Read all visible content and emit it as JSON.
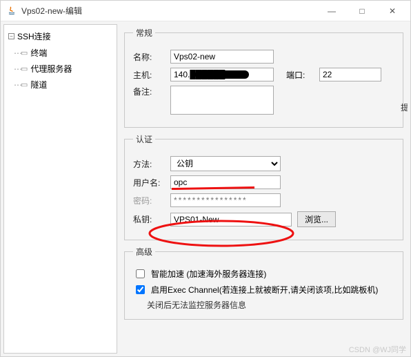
{
  "window": {
    "title": "Vps02-new-编辑",
    "min": "—",
    "max": "□",
    "close": "✕"
  },
  "sidebar": {
    "root": "SSH连接",
    "items": [
      "终端",
      "代理服务器",
      "隧道"
    ]
  },
  "general": {
    "legend": "常规",
    "name_label": "名称:",
    "name_value": "Vps02-new",
    "host_label": "主机:",
    "host_value": "140.██████",
    "port_label": "端口:",
    "port_value": "22",
    "remark_label": "备注:"
  },
  "auth": {
    "legend": "认证",
    "method_label": "方法:",
    "method_value": "公钥",
    "user_label": "用户名:",
    "user_value": "opc",
    "pass_label": "密码:",
    "pass_placeholder": "****************",
    "key_label": "私钥:",
    "key_value": "VPS01-New",
    "browse": "浏览..."
  },
  "advanced": {
    "legend": "高级",
    "accel": "智能加速 (加速海外服务器连接)",
    "exec": "启用Exec Channel(若连接上就被断开,请关闭该项,比如跳板机)",
    "exec_note": "关闭后无法监控服务器信息"
  },
  "edge_text": "提",
  "watermark": "CSDN @WJ同学"
}
